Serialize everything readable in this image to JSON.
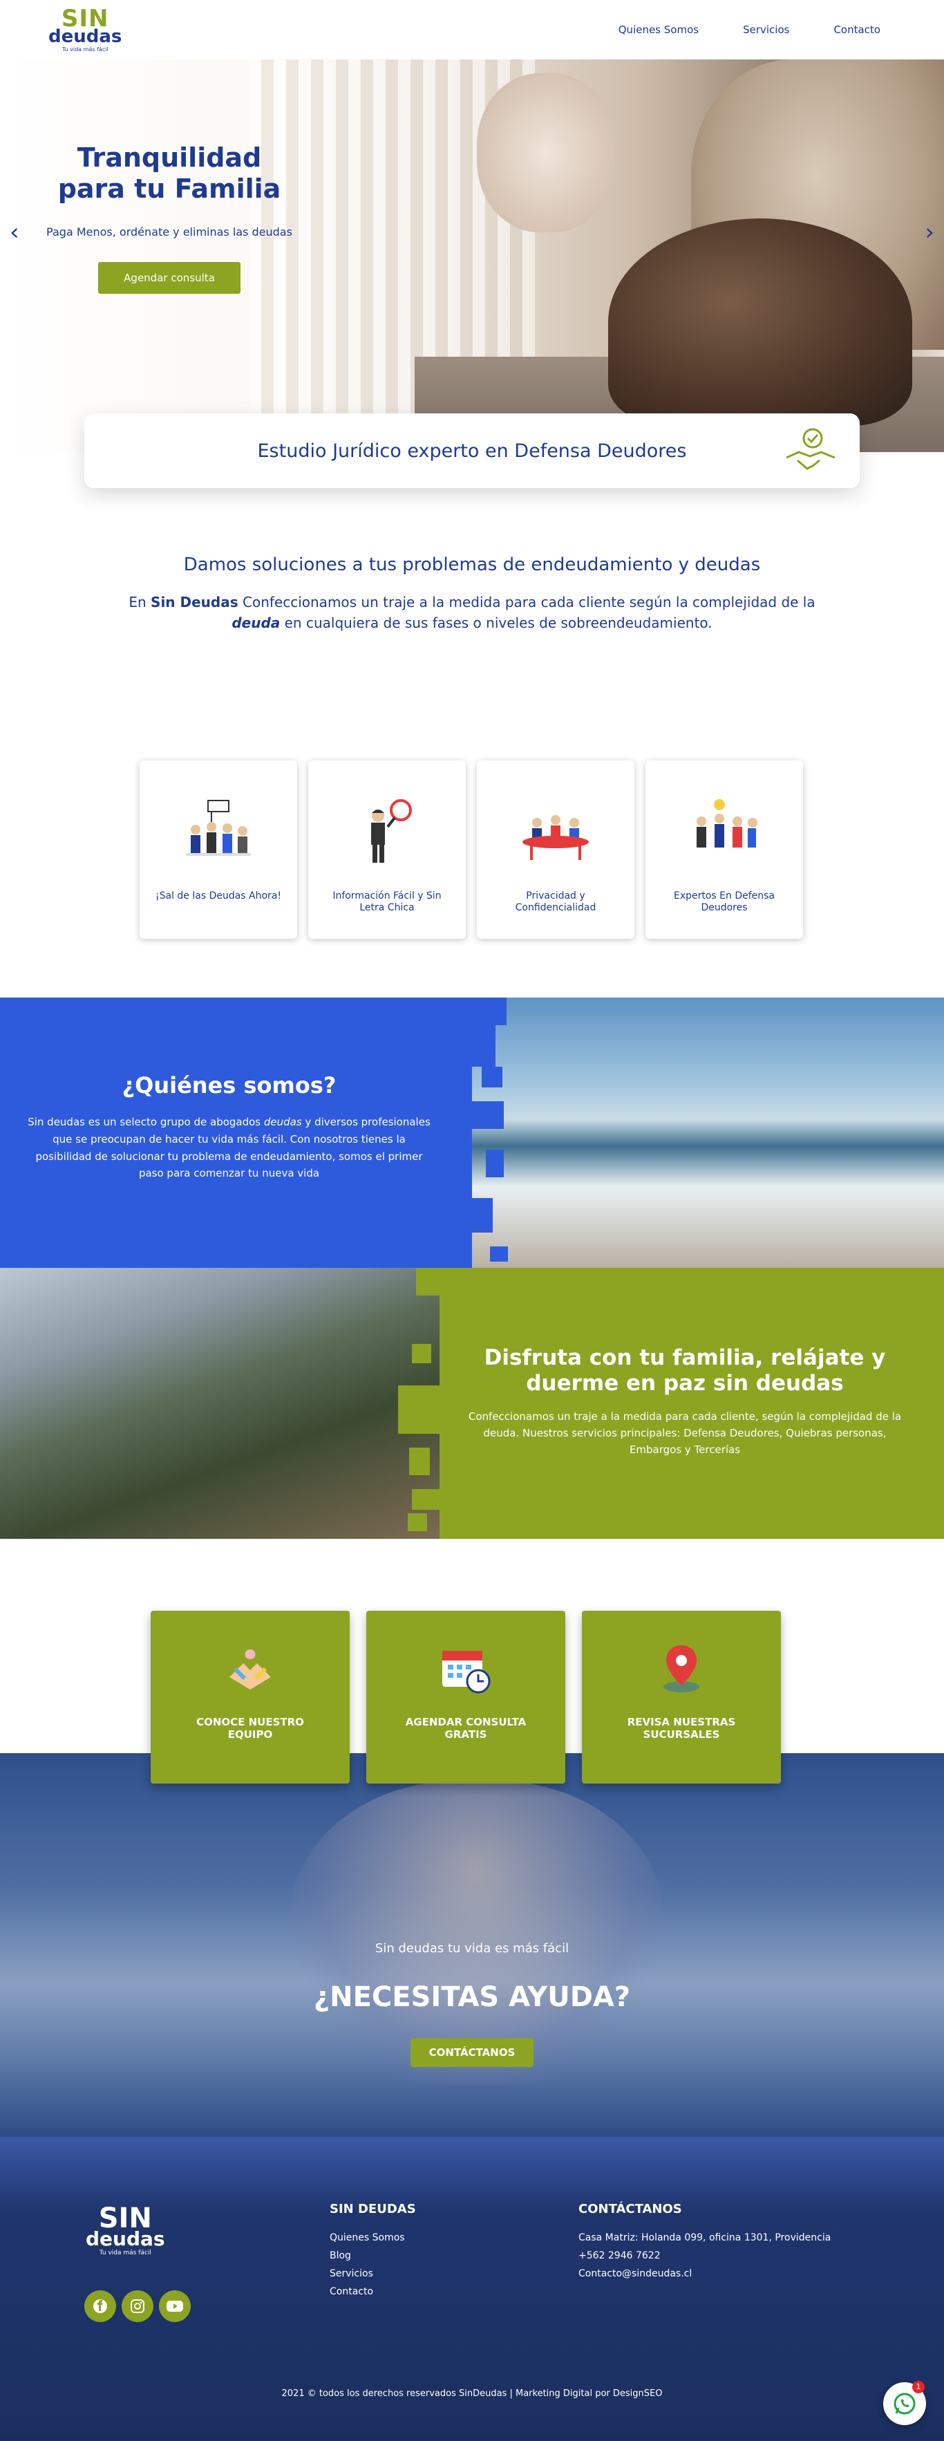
{
  "header": {
    "logo_top": "SIN",
    "logo_main": "deudas",
    "logo_tag": "Tu vida más fácil",
    "nav": [
      "Quienes Somos",
      "Servicios",
      "Contacto"
    ]
  },
  "hero": {
    "title": "Tranquilidad\npara tu Familia",
    "subtitle": "Paga Menos, ordénate y eliminas las deudas",
    "button": "Agendar consulta",
    "prev_arrow": "‹",
    "next_arrow": "›"
  },
  "feature": {
    "text": "Estudio Jurídico experto en Defensa Deudores"
  },
  "intro": {
    "title": "Damos soluciones a tus problemas de endeudamiento y deudas",
    "p_pre": "En ",
    "p_brand": "Sin Deudas",
    "p_mid": " Confeccionamos un traje a la medida para cada cliente según la complejidad de la ",
    "p_em": "deuda",
    "p_post": " en cualquiera de sus fases o niveles de sobreendeudamiento."
  },
  "cards": [
    {
      "label": "¡Sal de las Deudas Ahora!",
      "icon": "people-celebrating-icon"
    },
    {
      "label": "Información Fácil y Sin Letra Chica",
      "icon": "magnifier-man-icon"
    },
    {
      "label": "Privacidad y Confidencialidad",
      "icon": "meeting-table-icon"
    },
    {
      "label": "Expertos En Defensa Deudores",
      "icon": "idea-team-icon"
    }
  ],
  "quienes": {
    "title": "¿Quiénes somos?",
    "p_pre": "Sin deudas es un selecto grupo de abogados ",
    "p_em": "deudas",
    "p_post": " y diversos profesionales que se preocupan de hacer tu vida más fácil. Con nosotros tienes la posibilidad de solucionar tu problema de endeudamiento, somos el primer paso para comenzar tu nueva vida"
  },
  "disfruta": {
    "title": "Disfruta con tu familia, relájate y duerme en paz sin deudas",
    "text": "Confeccionamos un traje a la medida para cada cliente, según la complejidad de la deuda. Nuestros servicios principales: Defensa Deudores, Quiebras personas, Embargos y Tercerías"
  },
  "actions": [
    {
      "label": "CONOCE NUESTRO EQUIPO",
      "icon": "team-hands-icon"
    },
    {
      "label": "AGENDAR CONSULTA GRATIS",
      "icon": "calendar-clock-icon"
    },
    {
      "label": "REVISA NUESTRAS SUCURSALES",
      "icon": "map-pin-icon"
    }
  ],
  "help": {
    "subtitle": "Sin deudas tu vida es más fácil",
    "title": "¿NECESITAS AYUDA?",
    "button": "CONTÁCTANOS"
  },
  "footer": {
    "logo_top": "SIN",
    "logo_main": "deudas",
    "logo_tag": "Tu vida más fácil",
    "col1_title": "SIN DEUDAS",
    "col1_links": [
      "Quienes Somos",
      "Blog",
      "Servicios",
      "Contacto"
    ],
    "col2_title": "CONTÁCTANOS",
    "col2_lines": [
      "Casa Matriz: Holanda 099, oficina 1301, Providencia",
      "+562 2946 7622",
      "Contacto@sindeudas.cl"
    ],
    "copyright": "2021 © todos los derechos reservados SinDeudas | Marketing Digital por DesignSEO"
  },
  "whatsapp": {
    "badge": "1"
  },
  "colors": {
    "brand_blue": "#1f3a8f",
    "brand_green": "#8da322",
    "section_blue": "#2e5bdb"
  }
}
